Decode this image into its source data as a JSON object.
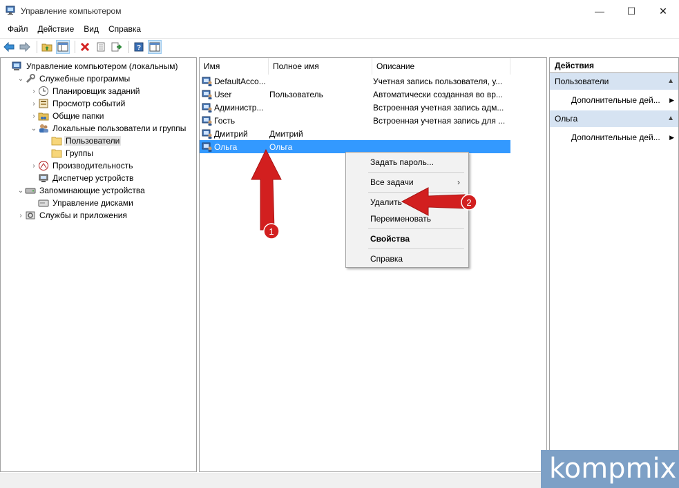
{
  "window": {
    "title": "Управление компьютером",
    "minimize": "—",
    "maximize": "☐",
    "close": "✕"
  },
  "menu": [
    "Файл",
    "Действие",
    "Вид",
    "Справка"
  ],
  "tree": [
    {
      "label": "Управление компьютером (локальным)",
      "level": 0,
      "expander": "",
      "icon": "computer-management-icon"
    },
    {
      "label": "Служебные программы",
      "level": 1,
      "expander": "⌄",
      "icon": "tools-icon"
    },
    {
      "label": "Планировщик заданий",
      "level": 2,
      "expander": "›",
      "icon": "clock-icon"
    },
    {
      "label": "Просмотр событий",
      "level": 2,
      "expander": "›",
      "icon": "event-viewer-icon"
    },
    {
      "label": "Общие папки",
      "level": 2,
      "expander": "›",
      "icon": "shared-folder-icon"
    },
    {
      "label": "Локальные пользователи и группы",
      "level": 2,
      "expander": "⌄",
      "icon": "users-icon"
    },
    {
      "label": "Пользователи",
      "level": 3,
      "expander": "",
      "icon": "folder-icon",
      "selected": true
    },
    {
      "label": "Группы",
      "level": 3,
      "expander": "",
      "icon": "folder-icon"
    },
    {
      "label": "Производительность",
      "level": 2,
      "expander": "›",
      "icon": "performance-icon"
    },
    {
      "label": "Диспетчер устройств",
      "level": 2,
      "expander": "",
      "icon": "device-manager-icon"
    },
    {
      "label": "Запоминающие устройства",
      "level": 1,
      "expander": "⌄",
      "icon": "storage-icon"
    },
    {
      "label": "Управление дисками",
      "level": 2,
      "expander": "",
      "icon": "disk-icon"
    },
    {
      "label": "Службы и приложения",
      "level": 1,
      "expander": "›",
      "icon": "services-icon"
    }
  ],
  "list": {
    "columns": [
      "Имя",
      "Полное имя",
      "Описание"
    ],
    "rows": [
      {
        "name": "DefaultAcco...",
        "full_name": "",
        "description": "Учетная запись пользователя, у..."
      },
      {
        "name": "User",
        "full_name": "Пользователь",
        "description": "Автоматически созданная во вр..."
      },
      {
        "name": "Администр...",
        "full_name": "",
        "description": "Встроенная учетная запись адм..."
      },
      {
        "name": "Гость",
        "full_name": "",
        "description": "Встроенная учетная запись для ..."
      },
      {
        "name": "Дмитрий",
        "full_name": "Дмитрий",
        "description": ""
      },
      {
        "name": "Ольга",
        "full_name": "Ольга",
        "description": "",
        "selected": true
      }
    ]
  },
  "context_menu": {
    "set_password": "Задать пароль...",
    "all_tasks": "Все задачи",
    "delete": "Удалить",
    "rename": "Переименовать",
    "properties": "Свойства",
    "help": "Справка"
  },
  "actions": {
    "header": "Действия",
    "section1": "Пользователи",
    "section1_item": "Дополнительные дей...",
    "section2": "Ольга",
    "section2_item": "Дополнительные дей..."
  },
  "annotations": {
    "arrow1_label": "1",
    "arrow2_label": "2",
    "color": "#d21f1f"
  },
  "watermark": "kompmix",
  "colors": {
    "selection": "#3399ff",
    "action_section": "#d6e3f2"
  }
}
